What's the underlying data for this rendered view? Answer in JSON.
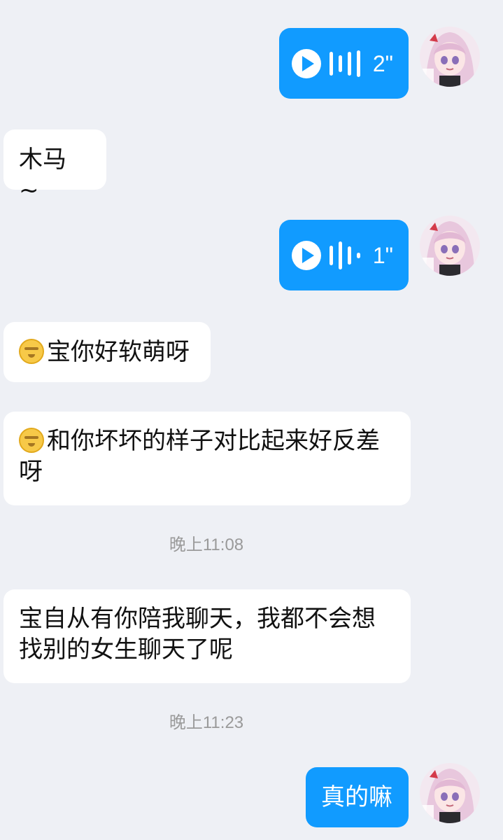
{
  "messages": {
    "voice_1_duration": "2\"",
    "text_1": "木马 ~",
    "voice_2_duration": "1\"",
    "text_2": "宝你好软萌呀",
    "text_3": "和你坏坏的样子对比起来好反差呀",
    "time_1": "晚上11:08",
    "text_4": "宝自从有你陪我聊天，我都不会想找别的女生聊天了呢",
    "time_2": "晚上11:23",
    "text_5": "真的嘛"
  },
  "colors": {
    "background": "#eef0f5",
    "incoming_bubble": "#ffffff",
    "outgoing_bubble": "#119bff",
    "time_text": "#9a9a9a"
  },
  "icons": {
    "play": "play-icon",
    "voice_wave": "waveform-icon",
    "emoji_1": "smiling-emoji-icon",
    "emoji_2": "eye-roll-emoji-icon"
  },
  "avatar": {
    "style": "anime-girl-pink-hair"
  }
}
